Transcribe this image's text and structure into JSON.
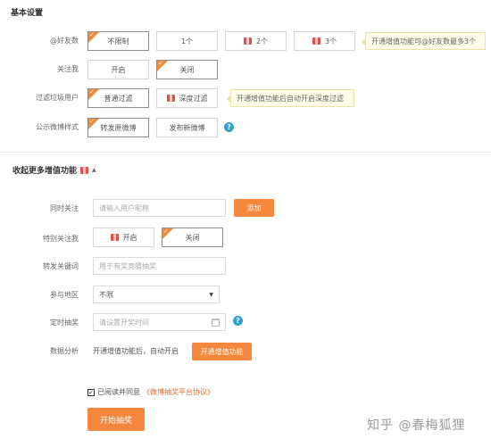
{
  "basic": {
    "title": "基本设置",
    "mention": {
      "label": "@好友数",
      "options": [
        "不限制",
        "1个",
        "2个",
        "3个"
      ],
      "tip": "开通增值功能可@好友数最多3个"
    },
    "follow": {
      "label": "关注我",
      "options": [
        "开启",
        "关闭"
      ]
    },
    "filter": {
      "label": "过滤垃圾用户",
      "options": [
        "普通过滤",
        "深度过滤"
      ],
      "tip": "开通增值功能后自动开启深度过滤"
    },
    "style": {
      "label": "公示微博样式",
      "options": [
        "转发原微博",
        "发布新微博"
      ]
    }
  },
  "advanced": {
    "title": "收起更多增值功能",
    "cofollow": {
      "label": "同时关注",
      "placeholder": "请输入用户昵称",
      "add_label": "添加"
    },
    "special_follow": {
      "label": "特别关注我",
      "options": [
        "开启",
        "关闭"
      ]
    },
    "keyword": {
      "label": "转发关键词",
      "placeholder": "用于有奖竞猜抽奖"
    },
    "region": {
      "label": "参与地区",
      "value": "不限"
    },
    "timer": {
      "label": "定时抽奖",
      "placeholder": "请设置开奖时间"
    },
    "analytics": {
      "label": "数据分析",
      "text": "开通增值功能后，自动开启",
      "button": "开通增值功能"
    }
  },
  "agreement": {
    "prefix": "已阅读并同意",
    "link": "《微博抽奖平台协议》"
  },
  "start_button": "开始抽奖",
  "watermark": "知乎 @春梅狐狸",
  "colors": {
    "accent": "#f5873d",
    "gift": "#d9534f",
    "help": "#2f9fd8",
    "link": "#e36b2c"
  }
}
